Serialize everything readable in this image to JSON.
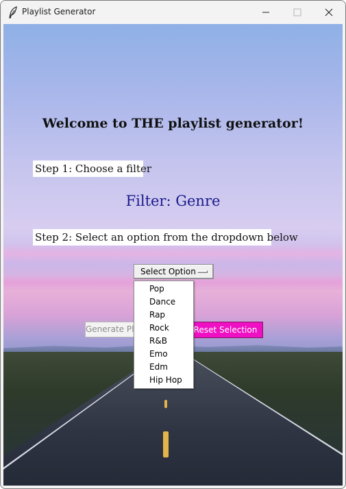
{
  "window": {
    "title": "Playlist Generator",
    "icon": "feather-icon",
    "controls": [
      "minimize-icon",
      "maximize-icon",
      "close-icon"
    ]
  },
  "main": {
    "heading": "Welcome to THE playlist generator!",
    "step1": "Step 1: Choose a filter",
    "filter_label": "Filter: Genre",
    "step2": "Step 2: Select an option from the dropdown below",
    "option_button": "Select Option",
    "generate_button": "Generate Playlist",
    "reset_button": "Reset Selection"
  },
  "dropdown": {
    "options": [
      "Pop",
      "Dance",
      "Rap",
      "Rock",
      "R&B",
      "Emo",
      "Edm",
      "Hip Hop"
    ]
  },
  "colors": {
    "reset_button_bg": "#ef10c4",
    "filter_text": "#1a1a8c"
  }
}
